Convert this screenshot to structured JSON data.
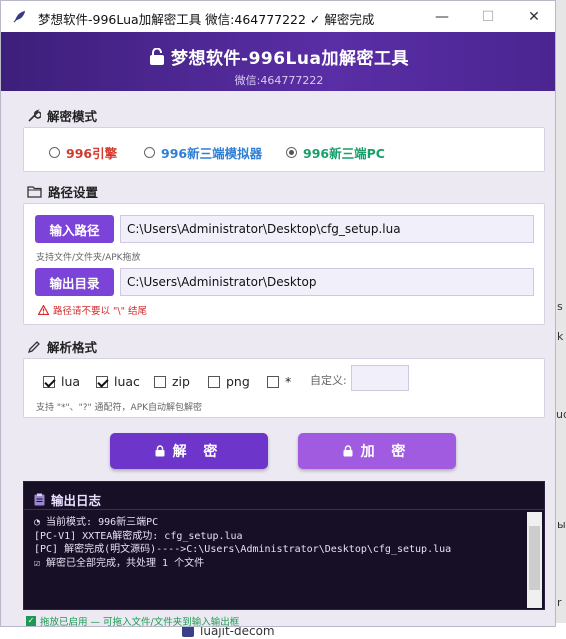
{
  "background": {
    "right_fragments": [
      "s",
      "k",
      "ud",
      "ы",
      "r"
    ],
    "left_fragments": [
      "b",
      "a",
      "B"
    ],
    "bottom_text": "luajit-decom"
  },
  "titlebar": {
    "title": "梦想软件-996Lua加解密工具    微信:464777222  ✓ 解密完成",
    "minimize": "—",
    "maximize": "☐",
    "close": "✕"
  },
  "header": {
    "title": "梦想软件-996Lua加解密工具",
    "subtitle": "微信:464777222"
  },
  "mode_section": {
    "heading": "解密模式",
    "options": [
      {
        "label": "996引擎",
        "color": "#d23a2e",
        "selected": false
      },
      {
        "label": "996新三端模拟器",
        "color": "#2f7fd6",
        "selected": false
      },
      {
        "label": "996新三端PC",
        "color": "#18a06a",
        "selected": true
      }
    ]
  },
  "path_section": {
    "heading": "路径设置",
    "input_button": "输入路径",
    "input_value": "C:\\Users\\Administrator\\Desktop\\cfg_setup.lua",
    "input_hint": "支持文件/文件夹/APK拖放",
    "output_button": "输出目录",
    "output_value": "C:\\Users\\Administrator\\Desktop",
    "warning": "路径请不要以 \"\\\" 结尾"
  },
  "format_section": {
    "heading": "解析格式",
    "formats": [
      {
        "label": "lua",
        "checked": true
      },
      {
        "label": "luac",
        "checked": true
      },
      {
        "label": "zip",
        "checked": false
      },
      {
        "label": "png",
        "checked": false
      },
      {
        "label": "*",
        "checked": false
      }
    ],
    "custom_label": "自定义:",
    "custom_value": "",
    "hint": "支持 \"*\"、\"?\" 通配符，APK自动解包解密"
  },
  "actions": {
    "decrypt": "解 密",
    "encrypt": "加 密",
    "decrypt_color": "#6d35c9",
    "encrypt_color": "#a15be0"
  },
  "log": {
    "heading": "输出日志",
    "lines": [
      "◔ 当前模式: 996新三端PC",
      "[PC-V1] XXTEA解密成功: cfg_setup.lua",
      "[PC] 解密完成(明文源码)---->C:\\Users\\Administrator\\Desktop\\cfg_setup.lua",
      "☑ 解密已全部完成，共处理 1 个文件"
    ]
  },
  "status": {
    "text": "拖放已启用 — 可拖入文件/文件夹到输入输出框"
  }
}
